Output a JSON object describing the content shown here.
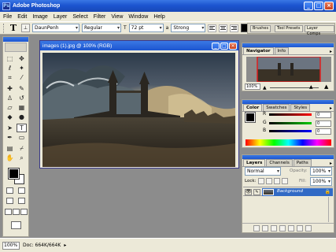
{
  "window": {
    "title": "Adobe Photoshop"
  },
  "menu": [
    "File",
    "Edit",
    "Image",
    "Layer",
    "Select",
    "Filter",
    "View",
    "Window",
    "Help"
  ],
  "options": {
    "font_family": "DaunPenh",
    "font_style": "Regular",
    "font_size": "72 pt",
    "aa_prefix": "a",
    "anti_alias": "Strong",
    "text_color": "#000000"
  },
  "well_tabs": [
    "Brushes",
    "Tool Presets",
    "Layer Comps"
  ],
  "document": {
    "title": "images (1).jpg @ 100% (RGB)"
  },
  "navigator": {
    "tabs": [
      "Navigator",
      "Info"
    ],
    "zoom": "100%"
  },
  "color_panel": {
    "tabs": [
      "Color",
      "Swatches",
      "Styles"
    ],
    "r": "0",
    "g": "0",
    "b": "0"
  },
  "layers": {
    "tabs": [
      "Layers",
      "Channels",
      "Paths"
    ],
    "blend_mode": "Normal",
    "opacity_label": "Opacity:",
    "opacity": "100%",
    "lock_label": "Lock:",
    "fill_label": "Fill:",
    "fill": "100%",
    "layer_name": "Background"
  },
  "status": {
    "zoom": "100%",
    "doc": "Doc: 664K/664K"
  }
}
